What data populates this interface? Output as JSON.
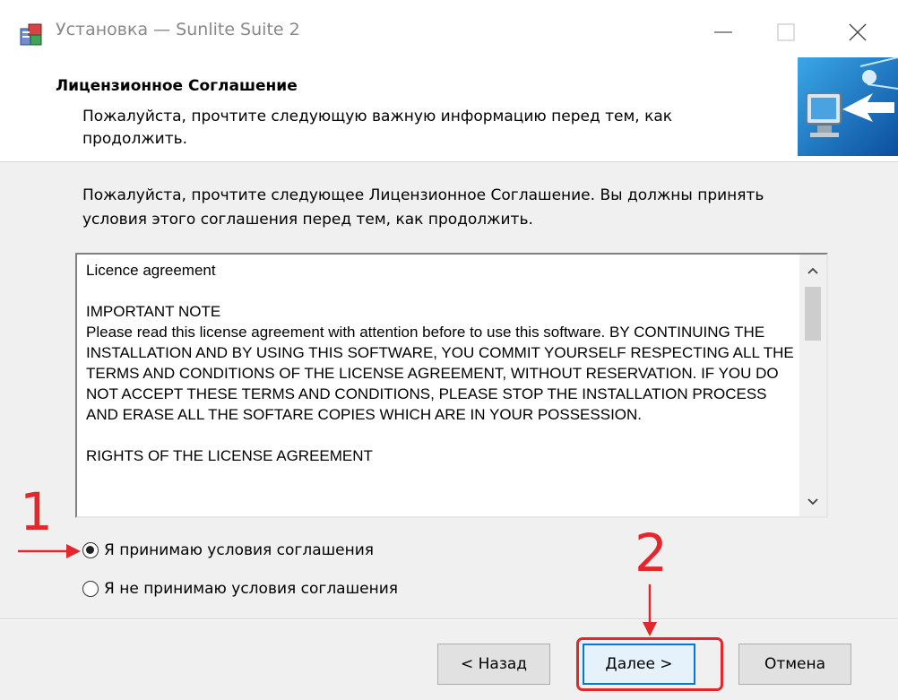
{
  "window": {
    "title": "Установка — Sunlite Suite 2"
  },
  "header": {
    "title": "Лицензионное Соглашение",
    "subtitle": "Пожалуйста, прочтите следующую важную информацию перед тем, как продолжить."
  },
  "intro_text": "Пожалуйста, прочтите следующее Лицензионное Соглашение. Вы должны принять условия этого соглашения перед тем, как продолжить.",
  "license": {
    "text": "Licence agreement\n\nIMPORTANT NOTE\nPlease read this license agreement with attention before to use this software. BY CONTINUING THE INSTALLATION AND BY USING THIS SOFTWARE, YOU COMMIT YOURSELF RESPECTING ALL THE TERMS AND CONDITIONS OF THE LICENSE AGREEMENT, WITHOUT RESERVATION. IF YOU DO NOT ACCEPT THESE TERMS AND CONDITIONS, PLEASE STOP THE INSTALLATION PROCESS AND ERASE ALL THE SOFTARE COPIES WHICH ARE IN YOUR POSSESSION.\n\nRIGHTS OF THE LICENSE AGREEMENT"
  },
  "options": {
    "accept": "Я принимаю условия соглашения",
    "decline": "Я не принимаю условия соглашения",
    "selected": "accept"
  },
  "buttons": {
    "back": "< Назад",
    "next": "Далее >",
    "cancel": "Отмена"
  },
  "annotations": {
    "step1": "1",
    "step2": "2",
    "color": "#e2282c"
  },
  "icons": {
    "app": "installer-icon",
    "header": "monitor-arrow-icon",
    "minimize": "minimize-icon",
    "maximize": "maximize-icon",
    "close": "close-icon",
    "scroll_up": "chevron-up-icon",
    "scroll_down": "chevron-down-icon"
  }
}
